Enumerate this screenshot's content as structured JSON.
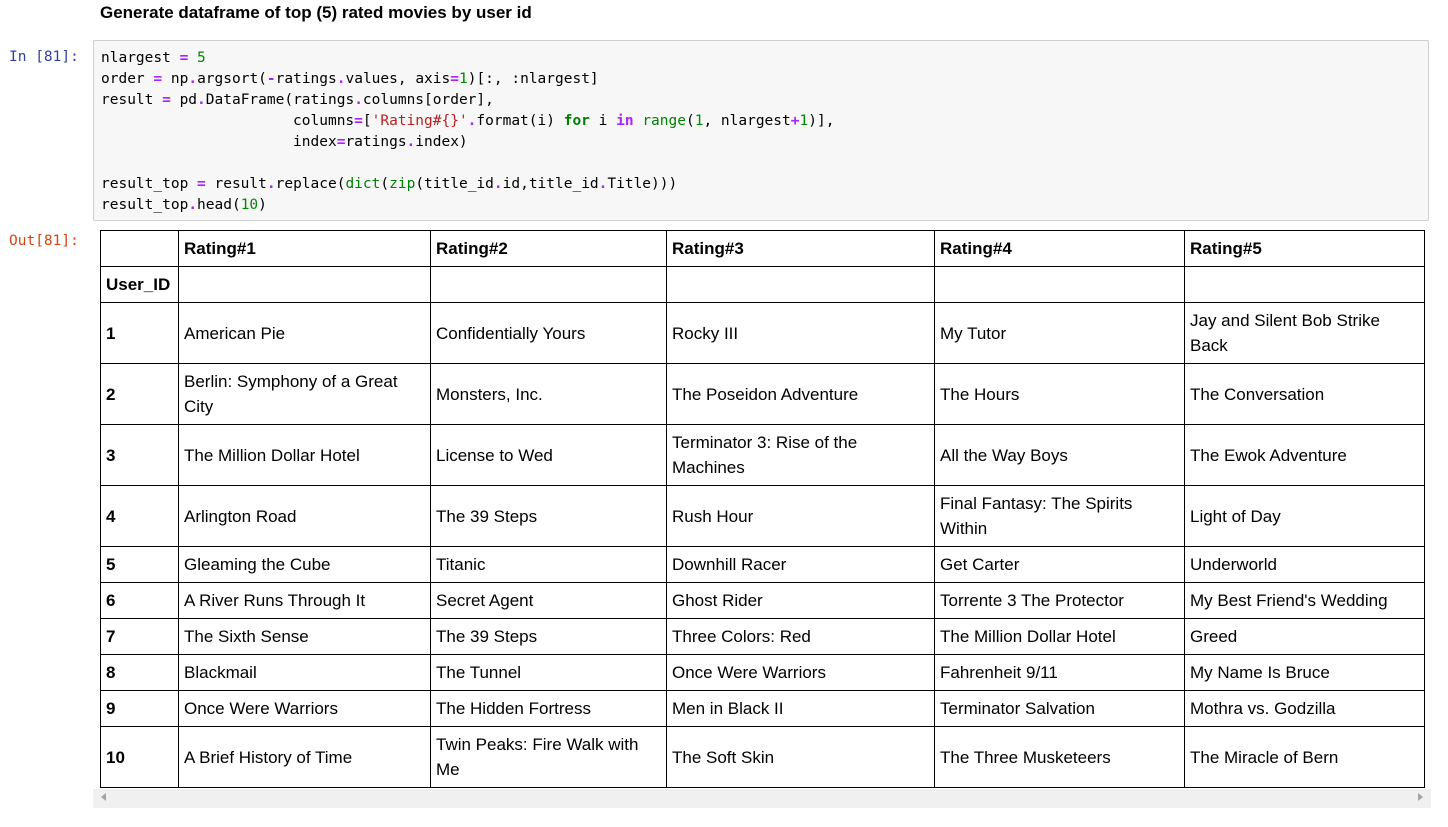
{
  "markdown": {
    "heading": "Generate dataframe of top (5) rated movies by user id"
  },
  "code_cell": {
    "in_prompt": "In [81]:",
    "out_prompt": "Out[81]:",
    "lines": [
      "nlargest = 5",
      "order = np.argsort(-ratings.values, axis=1)[:, :nlargest]",
      "result = pd.DataFrame(ratings.columns[order],",
      "                      columns=['Rating#{}'.format(i) for i in range(1, nlargest+1)],",
      "                      index=ratings.index)",
      "",
      "result_top = result.replace(dict(zip(title_id.id,title_id.Title)))",
      "result_top.head(10)"
    ]
  },
  "dataframe": {
    "index_name": "User_ID",
    "columns": [
      "Rating#1",
      "Rating#2",
      "Rating#3",
      "Rating#4",
      "Rating#5"
    ],
    "rows": [
      {
        "index": "1",
        "values": [
          "American Pie",
          "Confidentially Yours",
          "Rocky III",
          "My Tutor",
          "Jay and Silent Bob Strike Back"
        ]
      },
      {
        "index": "2",
        "values": [
          "Berlin: Symphony of a Great City",
          "Monsters, Inc.",
          "The Poseidon Adventure",
          "The Hours",
          "The Conversation"
        ]
      },
      {
        "index": "3",
        "values": [
          "The Million Dollar Hotel",
          "License to Wed",
          "Terminator 3: Rise of the Machines",
          "All the Way Boys",
          "The Ewok Adventure"
        ]
      },
      {
        "index": "4",
        "values": [
          "Arlington Road",
          "The 39 Steps",
          "Rush Hour",
          "Final Fantasy: The Spirits Within",
          "Light of Day"
        ]
      },
      {
        "index": "5",
        "values": [
          "Gleaming the Cube",
          "Titanic",
          "Downhill Racer",
          "Get Carter",
          "Underworld"
        ]
      },
      {
        "index": "6",
        "values": [
          "A River Runs Through It",
          "Secret Agent",
          "Ghost Rider",
          "Torrente 3 The Protector",
          "My Best Friend's Wedding"
        ]
      },
      {
        "index": "7",
        "values": [
          "The Sixth Sense",
          "The 39 Steps",
          "Three Colors: Red",
          "The Million Dollar Hotel",
          "Greed"
        ]
      },
      {
        "index": "8",
        "values": [
          "Blackmail",
          "The Tunnel",
          "Once Were Warriors",
          "Fahrenheit 9/11",
          "My Name Is Bruce"
        ]
      },
      {
        "index": "9",
        "values": [
          "Once Were Warriors",
          "The Hidden Fortress",
          "Men in Black II",
          "Terminator Salvation",
          "Mothra vs. Godzilla"
        ]
      },
      {
        "index": "10",
        "values": [
          "A Brief History of Time",
          "Twin Peaks: Fire Walk with Me",
          "The Soft Skin",
          "The Three Musketeers",
          "The Miracle of Bern"
        ]
      }
    ]
  },
  "scrollbar": {
    "left_icon": "chevron-left-icon",
    "right_icon": "chevron-right-icon"
  }
}
